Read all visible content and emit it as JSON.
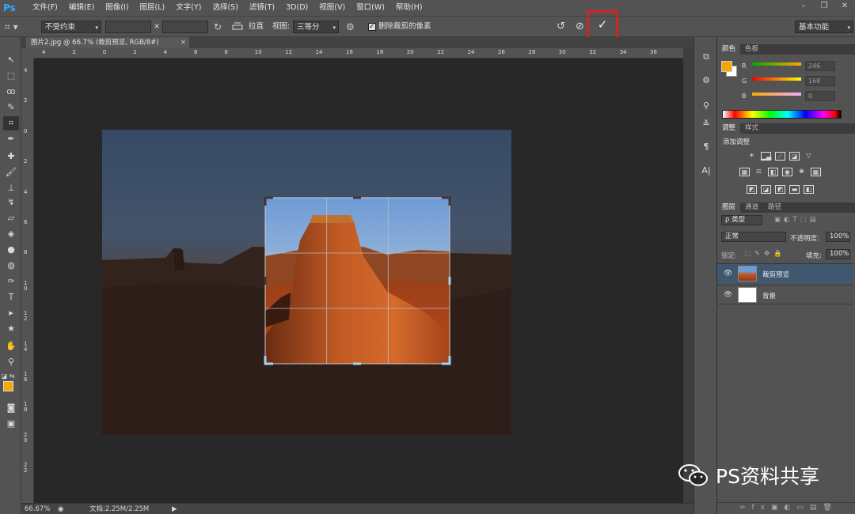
{
  "app": {
    "logo": "Ps"
  },
  "menu": [
    "文件(F)",
    "编辑(E)",
    "图像(I)",
    "图层(L)",
    "文字(Y)",
    "选择(S)",
    "滤镜(T)",
    "3D(D)",
    "视图(V)",
    "窗口(W)",
    "帮助(H)"
  ],
  "options": {
    "ratio": "不受约束",
    "width_value": "",
    "height_value": "",
    "x_sep": "×",
    "straighten": "拉直",
    "view_label": "视图:",
    "view_value": "三等分",
    "delete_pixels": "删除裁剪的像素",
    "delete_checked": true,
    "commit_symbol": "✓",
    "workspace": "基本功能"
  },
  "document": {
    "tab_title": "图片2.jpg @ 66.7% (裁剪预览, RGB/8#)",
    "zoom": "66.67%",
    "doc_size": "文档:2.25M/2.25M"
  },
  "rulers": {
    "h": [
      "4",
      "2",
      "0",
      "2",
      "4",
      "6",
      "8",
      "10",
      "12",
      "14",
      "16",
      "18",
      "20",
      "22",
      "24",
      "26",
      "28",
      "30",
      "32",
      "34",
      "36"
    ],
    "v": [
      "4",
      "2",
      "0",
      "2",
      "4",
      "6",
      "8",
      "1 0",
      "1 2",
      "1 4",
      "1 6",
      "1 8",
      "2 0",
      "2 2"
    ]
  },
  "color_panel": {
    "tabs": [
      "颜色",
      "色板"
    ],
    "r_label": "R",
    "g_label": "G",
    "b_label": "B",
    "r": "246",
    "g": "168",
    "b": "0",
    "foreground": "#f6a800",
    "background": "#ffffff"
  },
  "adjust_panel": {
    "tabs": [
      "调整",
      "样式"
    ],
    "title": "添加调整"
  },
  "layers_panel": {
    "tabs": [
      "图层",
      "通道",
      "路径"
    ],
    "filter": "ρ 类型",
    "blend_mode": "正常",
    "opacity_label": "不透明度:",
    "opacity": "100%",
    "lock_label": "锁定:",
    "fill_label": "填充:",
    "fill": "100%",
    "layers": [
      {
        "name": "裁剪预览",
        "selected": true
      },
      {
        "name": "背景",
        "selected": false
      }
    ]
  },
  "watermark": {
    "text": "PS资料共享"
  },
  "colors": {
    "accent_red": "#d22424",
    "selection_blue": "#3f5870"
  }
}
